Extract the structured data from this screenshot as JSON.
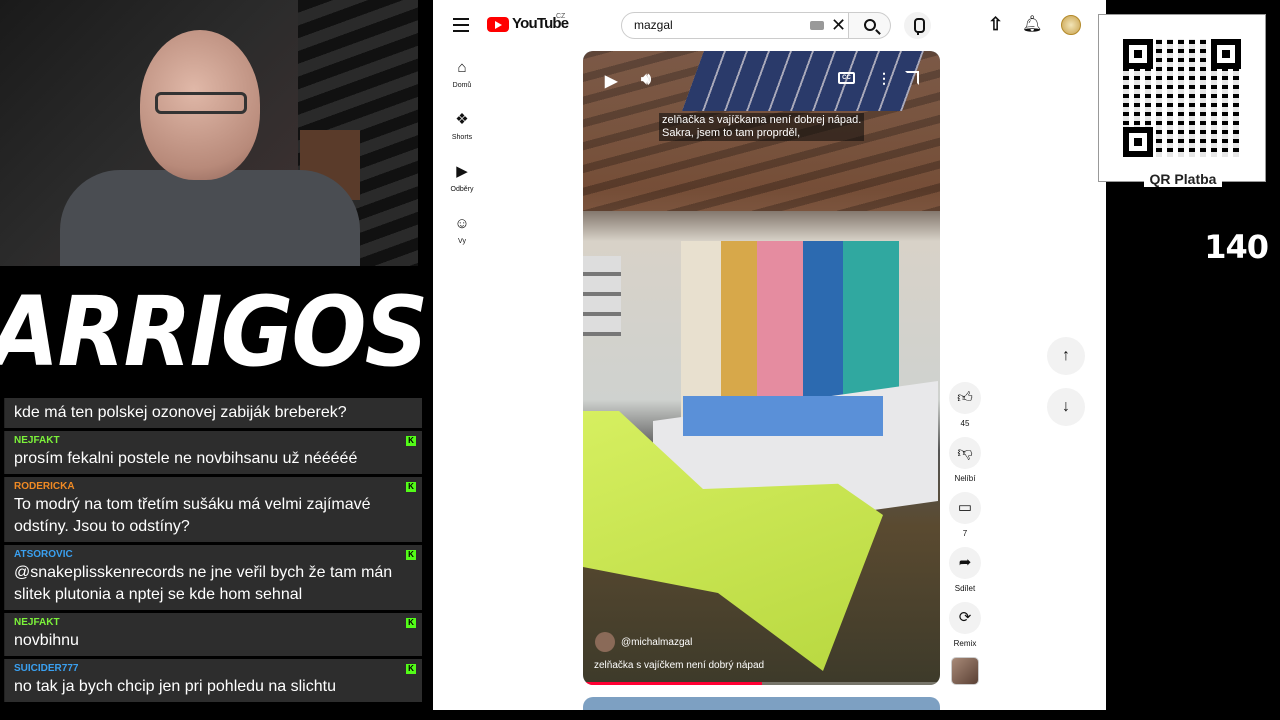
{
  "logo": {
    "text": "ARRIGOS"
  },
  "chat": {
    "messages": [
      {
        "user": "",
        "text": "kde má ten polskej ozonovej zabiják breberek?",
        "color": "#ffffff"
      },
      {
        "user": "NEJFAKT",
        "text": "prosím fekalni postele ne novbihsanu už nééééé",
        "color": "#7cf23a"
      },
      {
        "user": "RODERICKA",
        "text": "To modrý na tom třetím sušáku má velmi zajímavé odstíny. Jsou to odstíny?",
        "color": "#f08a24"
      },
      {
        "user": "ATSOROVIC",
        "text": "@snakeplisskenrecords ne jne veřil bych že tam mán slitek plutonia a nptej se kde hom sehnal",
        "color": "#3aa0f0"
      },
      {
        "user": "NEJFAKT",
        "text": "novbihnu",
        "color": "#7cf23a"
      },
      {
        "user": "SUICIDER777",
        "text": "no tak ja bych chcip jen pri pohledu na slichtu",
        "color": "#3aa0f0"
      }
    ]
  },
  "youtube": {
    "brand": "YouTube",
    "country": "CZ",
    "search_value": "mazgal",
    "rail": [
      {
        "icon": "home-icon",
        "label": "Domů",
        "glyph": "⌂"
      },
      {
        "icon": "shorts-icon",
        "label": "Shorts",
        "glyph": "❖"
      },
      {
        "icon": "subscriptions-icon",
        "label": "Odběry",
        "glyph": "▶"
      },
      {
        "icon": "you-icon",
        "label": "Vy",
        "glyph": "☺"
      }
    ],
    "video": {
      "subtitle": "zelňačka s vajíčkama není dobrej nápad.\nSakra, jsem to tam proprděl,",
      "channel": "@michalmazgal",
      "title": "zelňačka s vajíčkem není dobrý nápad"
    },
    "actions": {
      "likes": "45",
      "dislike_label": "Nelíbí",
      "comments": "7",
      "share_label": "Sdílet",
      "remix_label": "Remix"
    }
  },
  "qr": {
    "label": "QR Platba"
  },
  "counter": {
    "value": "140"
  }
}
